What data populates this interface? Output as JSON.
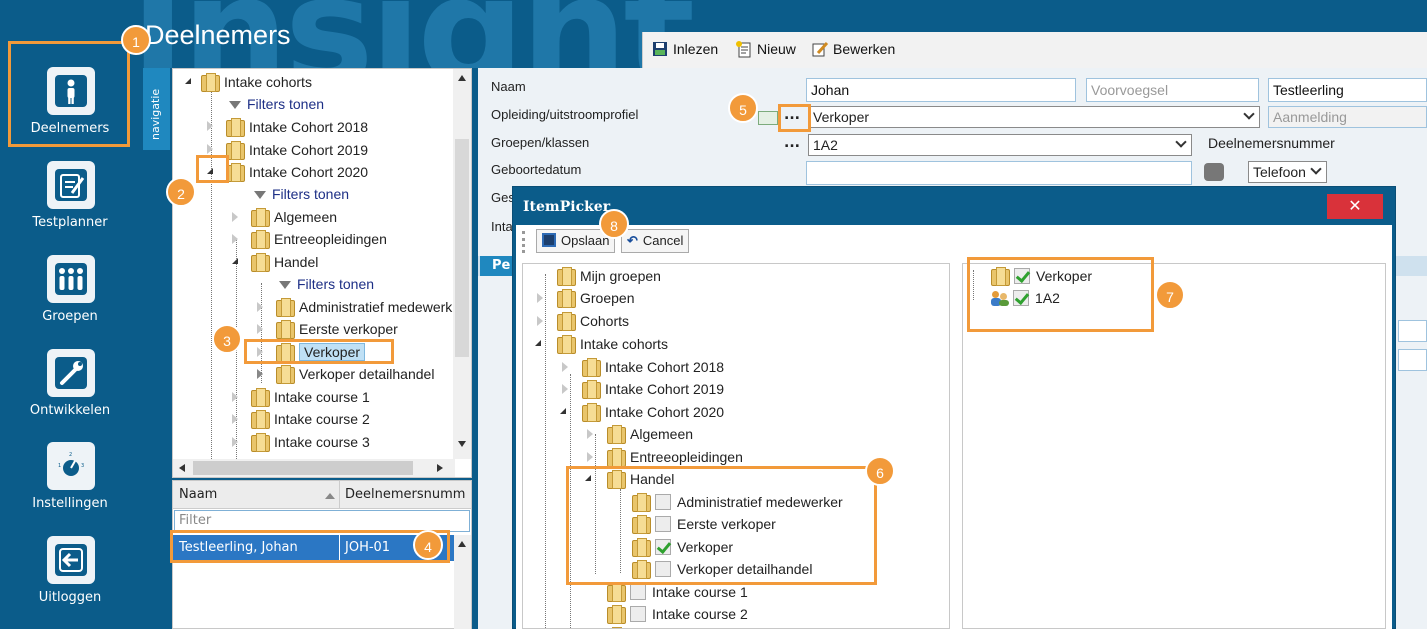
{
  "app": {
    "header_title": "Deelnemers",
    "background_word": "Insight",
    "sidebar": [
      {
        "label": "Deelnemers",
        "icon": "person-icon"
      },
      {
        "label": "Testplanner",
        "icon": "clipboard-icon"
      },
      {
        "label": "Groepen",
        "icon": "group-icon"
      },
      {
        "label": "Ontwikkelen",
        "icon": "wrench-icon"
      },
      {
        "label": "Instellingen",
        "icon": "dial-icon"
      },
      {
        "label": "Uitloggen",
        "icon": "logout-icon"
      }
    ]
  },
  "toolbar": {
    "inlezen": "Inlezen",
    "nieuw": "Nieuw",
    "bewerken": "Bewerken"
  },
  "navtab": "navigatie",
  "tree": {
    "items": [
      {
        "label": "Intake cohorts"
      },
      {
        "label": "Filters tonen"
      },
      {
        "label": "Intake Cohort 2018"
      },
      {
        "label": "Intake Cohort 2019"
      },
      {
        "label": "Intake Cohort 2020"
      },
      {
        "label": "Filters tonen"
      },
      {
        "label": "Algemeen"
      },
      {
        "label": "Entreeopleidingen"
      },
      {
        "label": "Handel"
      },
      {
        "label": "Filters tonen"
      },
      {
        "label": "Administratief medewerk"
      },
      {
        "label": "Eerste verkoper"
      },
      {
        "label": "Verkoper"
      },
      {
        "label": "Verkoper detailhandel"
      },
      {
        "label": "Intake course 1"
      },
      {
        "label": "Intake course 2"
      },
      {
        "label": "Intake course 3"
      }
    ]
  },
  "grid": {
    "col_naam": "Naam",
    "col_nummer": "Deelnemersnumm",
    "filter_placeholder": "Filter",
    "row": {
      "naam": "Testleerling, Johan",
      "nummer": "JOH-01"
    }
  },
  "form": {
    "naam_label": "Naam",
    "voornaam": "Johan",
    "voorvoegsel_placeholder": "Voorvoegsel",
    "achternaam": "Testleerling",
    "opleiding_label": "Opleiding/uitstroomprofiel",
    "opleiding_value": "Verkoper",
    "aanmelding": "Aanmelding",
    "groepen_label": "Groepen/klassen",
    "groepen_value": "1A2",
    "deelnemersnummer_label": "Deelnemersnummer",
    "geboortedatum_label": "Geboortedatum",
    "telefoon": "Telefoon",
    "truncated_label_1": "Ges",
    "truncated_label_2": "Inta",
    "tab_fragment": "Pe"
  },
  "dialog": {
    "title": "ItemPicker",
    "close": "✕",
    "save": "Opslaan",
    "cancel": "Cancel",
    "left_items": [
      {
        "label": "Mijn groepen"
      },
      {
        "label": "Groepen"
      },
      {
        "label": "Cohorts"
      },
      {
        "label": "Intake cohorts"
      },
      {
        "label": "Intake Cohort 2018"
      },
      {
        "label": "Intake Cohort 2019"
      },
      {
        "label": "Intake Cohort 2020"
      },
      {
        "label": "Algemeen"
      },
      {
        "label": "Entreeopleidingen"
      },
      {
        "label": "Handel"
      },
      {
        "label": "Administratief medewerker",
        "checked": false
      },
      {
        "label": "Eerste verkoper",
        "checked": false
      },
      {
        "label": "Verkoper",
        "checked": true
      },
      {
        "label": "Verkoper detailhandel",
        "checked": false
      },
      {
        "label": "Intake course 1",
        "checked": false
      },
      {
        "label": "Intake course 2",
        "checked": false
      }
    ],
    "right_items": [
      {
        "label": "Verkoper",
        "checked": true
      },
      {
        "label": "1A2",
        "checked": true
      }
    ]
  },
  "callouts": [
    "1",
    "2",
    "3",
    "4",
    "5",
    "6",
    "7",
    "8"
  ],
  "colors": {
    "accent": "#f29a3a",
    "app_blue": "#0b5c8a",
    "selection": "#2b77c4",
    "close_red": "#d9323a"
  }
}
